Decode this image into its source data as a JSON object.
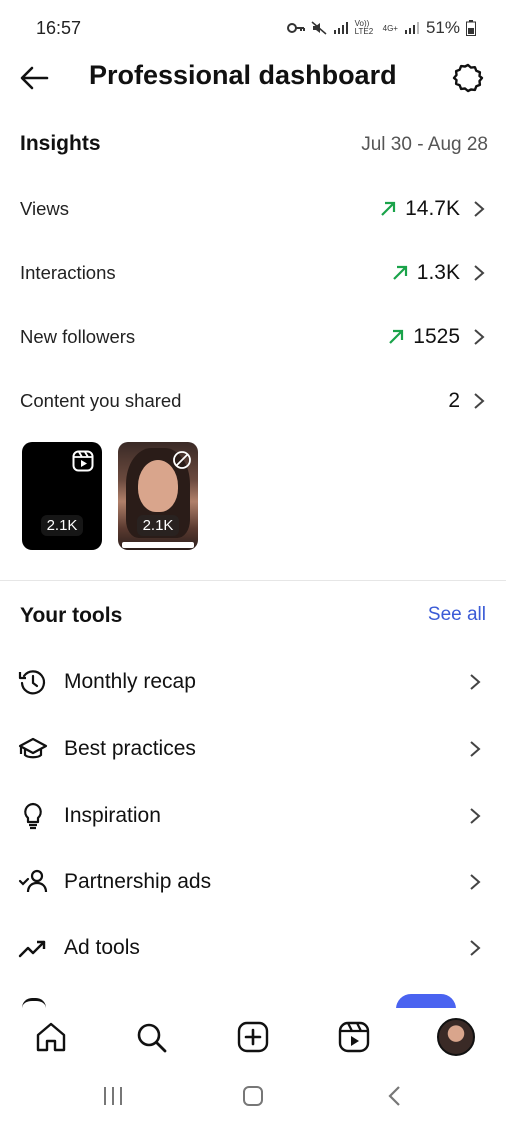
{
  "status": {
    "time": "16:57",
    "network_1": "Vo)) LTE2",
    "network_2": "4G+",
    "battery": "51%"
  },
  "header": {
    "title": "Professional dashboard",
    "back_icon": "arrow-left-icon",
    "settings_icon": "gear-icon"
  },
  "insights": {
    "title": "Insights",
    "range": "Jul 30 - Aug 28",
    "metrics": [
      {
        "label": "Views",
        "value": "14.7K",
        "trend": "up"
      },
      {
        "label": "Interactions",
        "value": "1.3K",
        "trend": "up"
      },
      {
        "label": "New followers",
        "value": "1525",
        "trend": "up"
      },
      {
        "label": "Content you shared",
        "value": "2",
        "trend": "none"
      }
    ],
    "trend_color": "#1aa34a",
    "content": [
      {
        "count": "2.1K",
        "type": "reel"
      },
      {
        "count": "2.1K",
        "type": "photo"
      }
    ]
  },
  "tools": {
    "title": "Your tools",
    "see_all": "See all",
    "accent_color": "#3b5bd6",
    "items": [
      {
        "label": "Monthly recap",
        "icon": "history-icon"
      },
      {
        "label": "Best practices",
        "icon": "graduation-cap-icon"
      },
      {
        "label": "Inspiration",
        "icon": "lightbulb-icon"
      },
      {
        "label": "Partnership ads",
        "icon": "partnership-user-icon"
      },
      {
        "label": "Ad tools",
        "icon": "trending-up-icon"
      }
    ]
  },
  "bottom_nav": {
    "items": [
      "home-icon",
      "search-icon",
      "create-icon",
      "reels-icon",
      "profile-avatar"
    ]
  },
  "system_nav": {
    "items": [
      "recents-icon",
      "home-button-icon",
      "back-icon"
    ]
  }
}
